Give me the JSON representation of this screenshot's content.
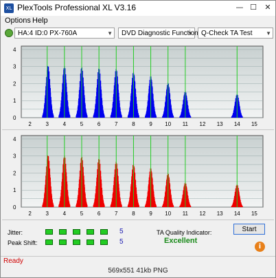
{
  "window": {
    "title": "PlexTools Professional XL V3.16",
    "app_icon": "XL",
    "minimize": "—",
    "maximize": "☐",
    "close": "✕"
  },
  "menu": {
    "options": "Options",
    "help": "Help"
  },
  "toolbar": {
    "drive": "HA:4 ID:0  PX-760A",
    "function": "DVD Diagnostic Functions",
    "test": "Q-Check TA Test"
  },
  "colors": {
    "top_series": "#0000ee",
    "bottom_series": "#ee0000",
    "guide_line": "#22cc22",
    "plot_bg_top": "#c8d0d0",
    "plot_bg_bottom": "#f2f4f4",
    "quality": "#1a8a1a",
    "status": "#d00000"
  },
  "chart_data": [
    {
      "type": "area",
      "series": [
        {
          "color": "#0000ee"
        }
      ],
      "x_ticks": [
        "2",
        "3",
        "4",
        "5",
        "6",
        "7",
        "8",
        "9",
        "10",
        "11",
        "12",
        "13",
        "14",
        "15"
      ],
      "y_ticks": [
        "4",
        "3.5",
        "3",
        "2.5",
        "2",
        "1.5",
        "1",
        "0.5",
        "0"
      ],
      "xlim": [
        1.5,
        15.5
      ],
      "ylim": [
        0,
        4.2
      ],
      "guide_lines": [
        3,
        4,
        5,
        6,
        7,
        8,
        9,
        10,
        11,
        14
      ],
      "peaks": [
        {
          "x": 3.05,
          "height": 3.1
        },
        {
          "x": 4.0,
          "height": 3.05
        },
        {
          "x": 5.0,
          "height": 3.0
        },
        {
          "x": 6.0,
          "height": 2.95
        },
        {
          "x": 7.0,
          "height": 2.9
        },
        {
          "x": 8.0,
          "height": 2.7
        },
        {
          "x": 9.0,
          "height": 2.45
        },
        {
          "x": 10.0,
          "height": 2.05
        },
        {
          "x": 11.0,
          "height": 1.55
        },
        {
          "x": 14.0,
          "height": 1.4
        }
      ]
    },
    {
      "type": "area",
      "series": [
        {
          "color": "#ee0000"
        }
      ],
      "x_ticks": [
        "2",
        "3",
        "4",
        "5",
        "6",
        "7",
        "8",
        "9",
        "10",
        "11",
        "12",
        "13",
        "14",
        "15"
      ],
      "y_ticks": [
        "4",
        "3.5",
        "3",
        "2.5",
        "2",
        "1.5",
        "1",
        "0.5",
        "0"
      ],
      "xlim": [
        1.5,
        15.5
      ],
      "ylim": [
        0,
        4.2
      ],
      "guide_lines": [
        3,
        4,
        5,
        6,
        7,
        8,
        9,
        10,
        11,
        14
      ],
      "peaks": [
        {
          "x": 3.05,
          "height": 3.1
        },
        {
          "x": 4.0,
          "height": 3.05
        },
        {
          "x": 5.0,
          "height": 3.0
        },
        {
          "x": 6.0,
          "height": 2.9
        },
        {
          "x": 7.0,
          "height": 2.7
        },
        {
          "x": 8.0,
          "height": 2.55
        },
        {
          "x": 9.0,
          "height": 2.3
        },
        {
          "x": 10.0,
          "height": 2.0
        },
        {
          "x": 11.0,
          "height": 1.45
        },
        {
          "x": 14.0,
          "height": 1.35
        }
      ]
    }
  ],
  "metrics": {
    "jitter_label": "Jitter:",
    "jitter_value": "5",
    "jitter_segments": 5,
    "peak_shift_label": "Peak Shift:",
    "peak_shift_value": "5",
    "peak_shift_segments": 5
  },
  "quality": {
    "label": "TA Quality Indicator:",
    "value": "Excellent"
  },
  "buttons": {
    "start": "Start",
    "info": "i"
  },
  "status": {
    "text": "Ready"
  },
  "caption": {
    "text": "569x551  41kb  PNG"
  }
}
